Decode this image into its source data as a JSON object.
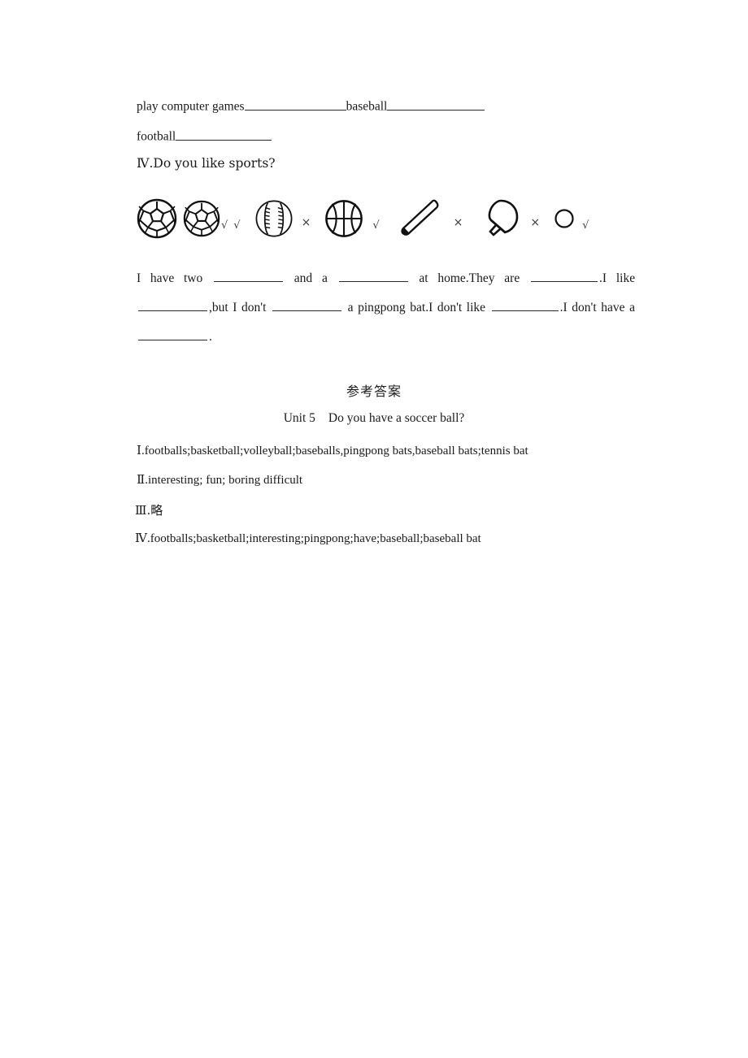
{
  "document": {
    "type": "english-worksheet-answer-key",
    "language": "en-zh"
  },
  "exercise_continuation": {
    "line1": {
      "text_a": "play computer games",
      "blank_a": "",
      "text_b": "baseball",
      "blank_b": ""
    },
    "line2": {
      "text_a": "football",
      "blank_a": ""
    }
  },
  "exercise4": {
    "heading": "Ⅳ.Do you like sports?",
    "icons": [
      {
        "name": "soccer-ball-icon",
        "label": "soccer ball",
        "mark": ""
      },
      {
        "name": "soccer-ball-icon",
        "label": "soccer ball",
        "mark": "√"
      },
      {
        "name": "check-mark-icon",
        "label": "check",
        "mark": "√"
      },
      {
        "name": "baseball-icon",
        "label": "baseball",
        "mark": "×"
      },
      {
        "name": "basketball-icon",
        "label": "basketball",
        "mark": "√"
      },
      {
        "name": "baseball-bat-icon",
        "label": "baseball bat",
        "mark": "×"
      },
      {
        "name": "pingpong-bat-icon",
        "label": "pingpong bat",
        "mark": "×"
      },
      {
        "name": "pingpong-ball-icon",
        "label": "pingpong ball",
        "mark": "√"
      }
    ],
    "marks": {
      "soccer": "√",
      "soccer2": "√",
      "baseball": "×",
      "basketball": "√",
      "bat": "×",
      "paddle": "×",
      "pingpong_ball": "√"
    },
    "sentence": {
      "s1": "I have two",
      "s2": "and a",
      "s3": "at home.They are",
      "s4": ".I like",
      "s5": ",but I don't",
      "s6": "a pingpong bat.I don't like",
      "s7": ".I don't have a",
      "s8": "."
    }
  },
  "answers": {
    "title": "参考答案",
    "unit": "Unit 5",
    "unit_question": "Do you have a soccer ball?",
    "items": [
      {
        "num": "Ⅰ",
        "text": ".footballs;basketball;volleyball;baseballs,pingpong bats,baseball bats;tennis bat"
      },
      {
        "num": "Ⅱ",
        "text": ".interesting; fun; boring difficult"
      },
      {
        "num": "Ⅲ",
        "text": ".略"
      },
      {
        "num": "Ⅳ",
        "text": ".footballs;basketball;interesting;pingpong;have;baseball;baseball bat"
      }
    ]
  },
  "colors": {
    "text": "#1a1a1a",
    "rule": "#2a2a2a",
    "background": "#ffffff"
  }
}
